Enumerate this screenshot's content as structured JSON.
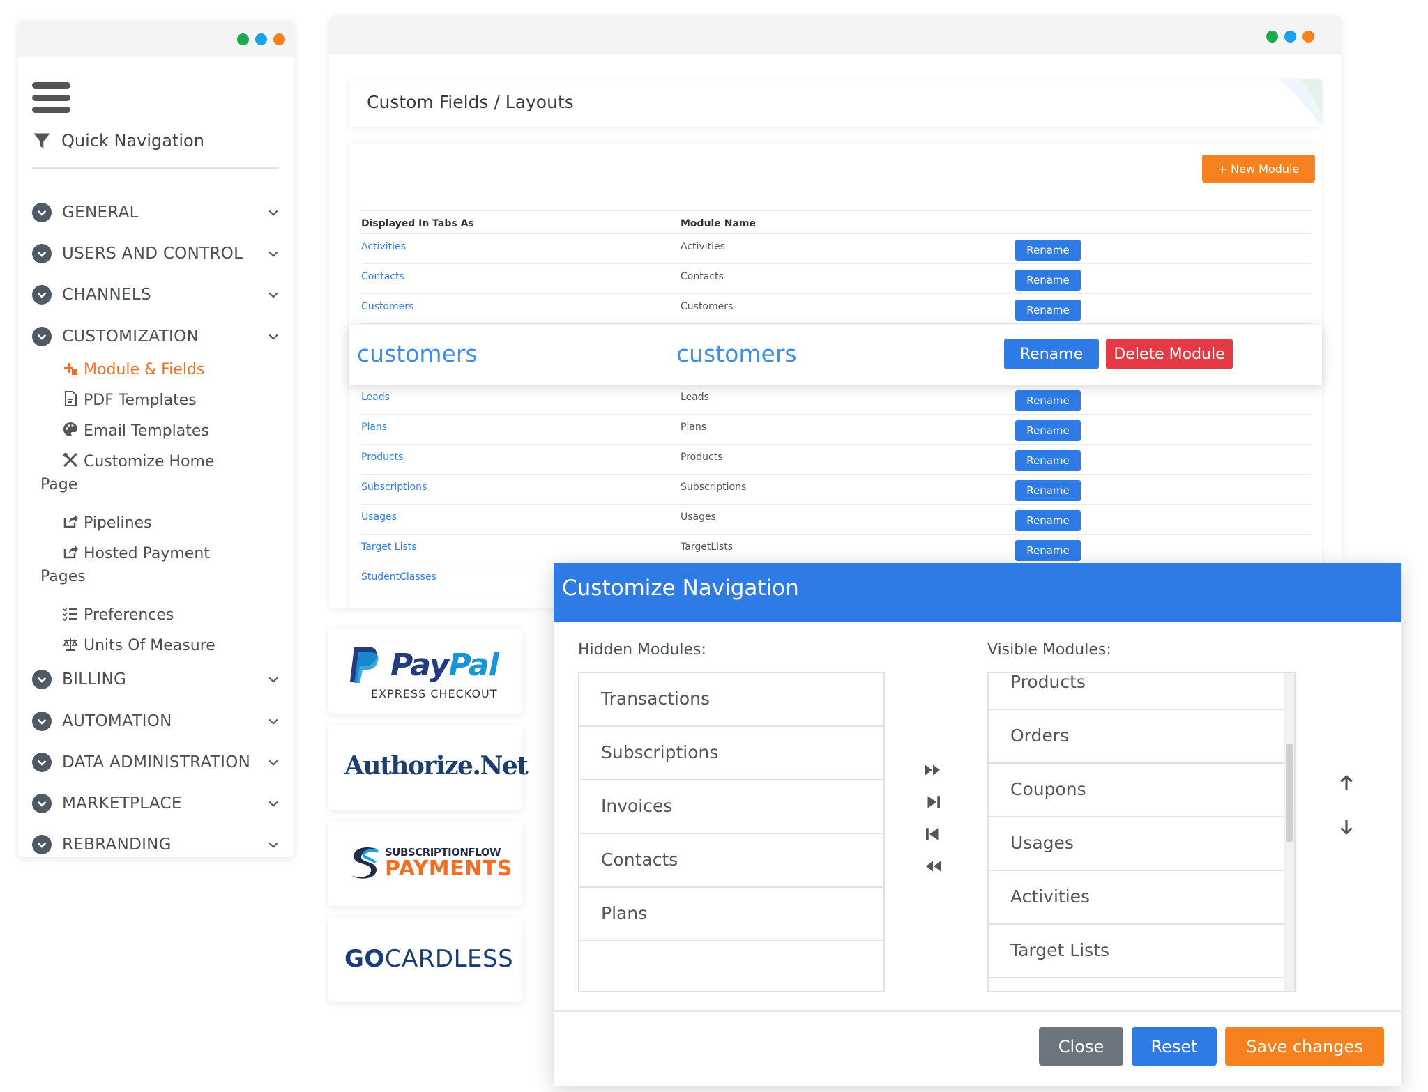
{
  "sidebar": {
    "quick_nav": "Quick Navigation",
    "sections_top": [
      "GENERAL",
      "USERS AND CONTROL",
      "CHANNELS",
      "CUSTOMIZATION"
    ],
    "sub_items": [
      {
        "icon": "puzzle-icon",
        "label": "Module & Fields",
        "active": true
      },
      {
        "icon": "pdf-file-icon",
        "label": "PDF Templates"
      },
      {
        "icon": "palette-icon",
        "label": "Email Templates"
      },
      {
        "icon": "tools-icon",
        "line1": "Customize Home",
        "line2": "Page"
      },
      {
        "icon": "share-icon",
        "label": "Pipelines"
      },
      {
        "icon": "share-icon",
        "line1": "Hosted Payment",
        "line2": "Pages"
      },
      {
        "icon": "list-check-icon",
        "label": "Preferences"
      },
      {
        "icon": "scale-icon",
        "label": "Units Of Measure"
      }
    ],
    "sections_bottom": [
      "BILLING",
      "AUTOMATION",
      "DATA ADMINISTRATION",
      "MARKETPLACE",
      "REBRANDING"
    ]
  },
  "main": {
    "breadcrumb": "Custom Fields / Layouts",
    "new_module_label": "+ New Module",
    "col_displayed": "Displayed In Tabs As",
    "col_module": "Module Name",
    "rename_label": "Rename",
    "rows": [
      {
        "displayed": "Activities",
        "module": "Activities"
      },
      {
        "displayed": "Contacts",
        "module": "Contacts"
      },
      {
        "displayed": "Customers",
        "module": "Customers"
      }
    ],
    "highlight": {
      "displayed": "customers",
      "module": "customers",
      "rename": "Rename",
      "delete": "Delete Module"
    },
    "rows_after": [
      {
        "displayed": "Leads",
        "module": "Leads"
      },
      {
        "displayed": "Plans",
        "module": "Plans"
      },
      {
        "displayed": "Products",
        "module": "Products"
      },
      {
        "displayed": "Subscriptions",
        "module": "Subscriptions"
      },
      {
        "displayed": "Usages",
        "module": "Usages"
      },
      {
        "displayed": "Target Lists",
        "module": "TargetLists"
      },
      {
        "displayed": "StudentClasses",
        "module": ""
      }
    ]
  },
  "logos": {
    "paypal_pay": "Pay",
    "paypal_pal": "Pal",
    "paypal_sub": "EXPRESS CHECKOUT",
    "authorize": "Authorize.Net",
    "sfp_top": "SUBSCRIPTIONFLOW",
    "sfp_bottom": "PAYMENTS",
    "gocardless_go": "GO",
    "gocardless_rest": "CARDLESS"
  },
  "modal": {
    "title": "Customize Navigation",
    "hidden_label": "Hidden Modules:",
    "visible_label": "Visible Modules:",
    "hidden": [
      "Transactions",
      "Subscriptions",
      "Invoices",
      "Contacts",
      "Plans"
    ],
    "visible": [
      "Products",
      "Orders",
      "Coupons",
      "Usages",
      "Activities",
      "Target Lists"
    ],
    "close": "Close",
    "reset": "Reset",
    "save": "Save changes"
  },
  "colors": {
    "accent_blue": "#2f7be6",
    "accent_orange": "#f5821f",
    "danger_red": "#e53946",
    "link_blue": "#2f7fe0"
  }
}
